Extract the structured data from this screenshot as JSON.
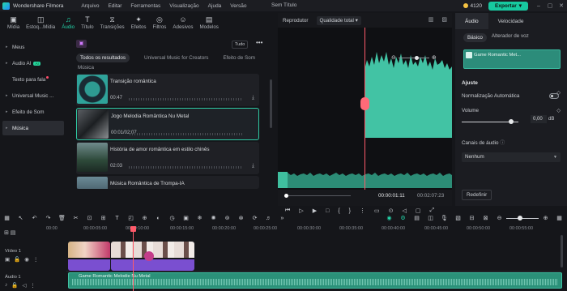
{
  "titlebar": {
    "app_name": "Wondershare Filmora",
    "menu": [
      "Arquivo",
      "Editar",
      "Ferramentas",
      "Visualização",
      "Ajuda",
      "Versão"
    ],
    "doc_title": "Sem Título",
    "credits": "4120",
    "export_label": "Exportar"
  },
  "mediabar": {
    "tabs": [
      {
        "label": "Mídia",
        "icon": "media-icon"
      },
      {
        "label": "Estoq...Mídia",
        "icon": "stock-media-icon"
      },
      {
        "label": "Áudio",
        "icon": "music-note-icon"
      },
      {
        "label": "Título",
        "icon": "title-icon"
      },
      {
        "label": "Transições",
        "icon": "transitions-icon"
      },
      {
        "label": "Efeitos",
        "icon": "effects-icon"
      },
      {
        "label": "Filtros",
        "icon": "filters-icon"
      },
      {
        "label": "Adesivos",
        "icon": "stickers-icon"
      },
      {
        "label": "Modelos",
        "icon": "templates-icon"
      }
    ],
    "active": "Áudio"
  },
  "sidebar": {
    "items": [
      {
        "label": "Meus"
      },
      {
        "label": "Audio AI",
        "badge": "AI"
      },
      {
        "label": "Texto para fala"
      },
      {
        "label": "Universal Music ..."
      },
      {
        "label": "Efeito de Som"
      },
      {
        "label": "Música"
      }
    ]
  },
  "browser": {
    "tudo": "Tudo",
    "filters": [
      "Todos os resultados",
      "Universal Music for Creators",
      "Efeito de Som"
    ],
    "section": "Música",
    "tracks": [
      {
        "title": "Transição romântica",
        "duration": "00:47"
      },
      {
        "title": "Jogo Melodia Romântica Nu Metal",
        "duration": "00:01/02:07"
      },
      {
        "title": "História de amor romântica em estilo chinês",
        "duration": "02:03"
      },
      {
        "title": "Música Romântica de Trompa-IA",
        "duration": ""
      }
    ]
  },
  "player": {
    "label": "Reprodutor",
    "quality": "Qualidade total",
    "current_time": "00:00:01:11",
    "total_time": "00:02:07:23"
  },
  "props": {
    "tabs": [
      "Áudio",
      "Velocidade"
    ],
    "subtabs": [
      "Básico",
      "Alterador de voz"
    ],
    "clip_name": "Game Romantic Met...",
    "section": "Ajuste",
    "auto_norm": "Normalização Automática",
    "volume_label": "Volume",
    "volume_value": "0,00",
    "volume_unit": "dB",
    "channels_label": "Canais de áudio",
    "channels_value": "Nenhum",
    "reset": "Redefinir"
  },
  "timeline": {
    "ruler": [
      "00:00",
      "00:00:05:00",
      "00:00:10:00",
      "00:00:15:00",
      "00:00:20:00",
      "00:00:25:00",
      "00:00:30:00",
      "00:00:35:00",
      "00:00:40:00",
      "00:00:45:00",
      "00:00:50:00",
      "00:00:55:00"
    ],
    "video_track": "Vídeo 1",
    "audio_track": "Áudio 1",
    "audio_clip": "Game Romantic Melodie Nu Metal"
  }
}
